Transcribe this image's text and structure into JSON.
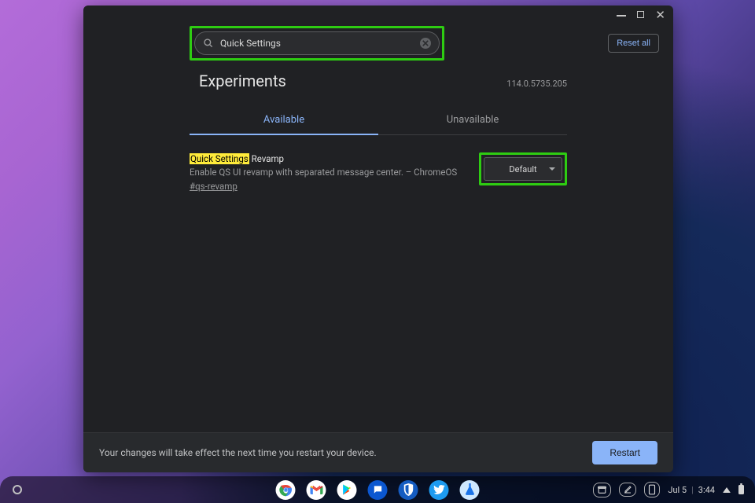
{
  "window_controls": {
    "minimize": "minimize",
    "maximize": "maximize",
    "close": "close"
  },
  "search": {
    "value": "Quick Settings"
  },
  "reset_label": "Reset all",
  "page_title": "Experiments",
  "version": "114.0.5735.205",
  "tabs": {
    "available": "Available",
    "unavailable": "Unavailable",
    "active": "available"
  },
  "flag": {
    "highlight": "Quick Settings",
    "title_rest": " Revamp",
    "description": "Enable QS UI revamp with separated message center. – ChromeOS",
    "anchor": "#qs-revamp",
    "select_value": "Default"
  },
  "footer": {
    "message": "Your changes will take effect the next time you restart your device.",
    "restart": "Restart"
  },
  "shelf": {
    "date": "Jul 5",
    "time": "3:44"
  }
}
